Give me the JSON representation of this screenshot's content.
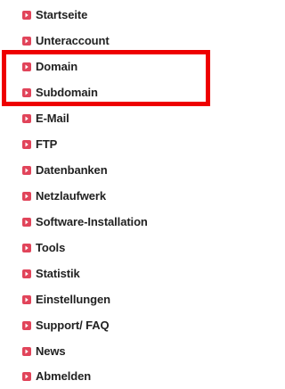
{
  "colors": {
    "icon": "#e1445a",
    "text": "#222222",
    "highlight": "#ee0000"
  },
  "icon_name": "arrow-bullet-icon",
  "nav": {
    "items": [
      {
        "label": "Startseite"
      },
      {
        "label": "Unteraccount"
      },
      {
        "label": "Domain"
      },
      {
        "label": "Subdomain"
      },
      {
        "label": "E-Mail"
      },
      {
        "label": "FTP"
      },
      {
        "label": "Datenbanken"
      },
      {
        "label": "Netzlaufwerk"
      },
      {
        "label": "Software-Installation"
      },
      {
        "label": "Tools"
      },
      {
        "label": "Statistik"
      },
      {
        "label": "Einstellungen"
      },
      {
        "label": "Support/ FAQ"
      },
      {
        "label": "News"
      },
      {
        "label": "Abmelden"
      }
    ]
  }
}
